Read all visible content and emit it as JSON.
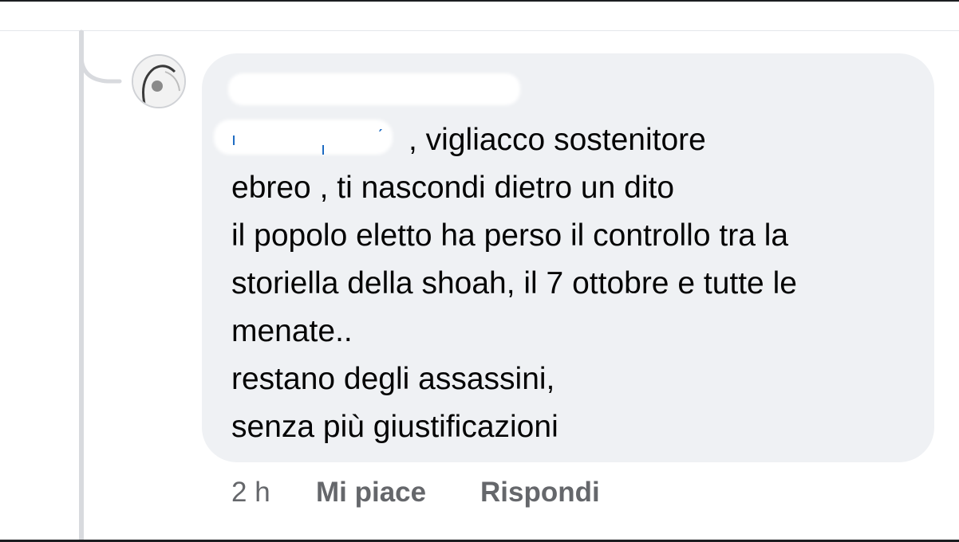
{
  "comment": {
    "author_name": "",
    "mention": "",
    "lines": [
      ", vigliacco sostenitore",
      "ebreo , ti nascondi dietro un dito",
      "il popolo eletto ha perso il controllo tra la",
      "storiella della shoah, il 7 ottobre e tutte le",
      "menate..",
      "restano degli assassini,",
      "senza più giustificazioni"
    ],
    "timestamp": "2 h",
    "actions": {
      "like": "Mi piace",
      "reply": "Rispondi"
    }
  },
  "colors": {
    "bubble": "#eff1f4",
    "text": "#050505",
    "meta": "#65676b",
    "mention": "#1565c0",
    "thread_line": "#d8dade"
  },
  "icons": {
    "avatar": "profile-avatar-icon"
  }
}
